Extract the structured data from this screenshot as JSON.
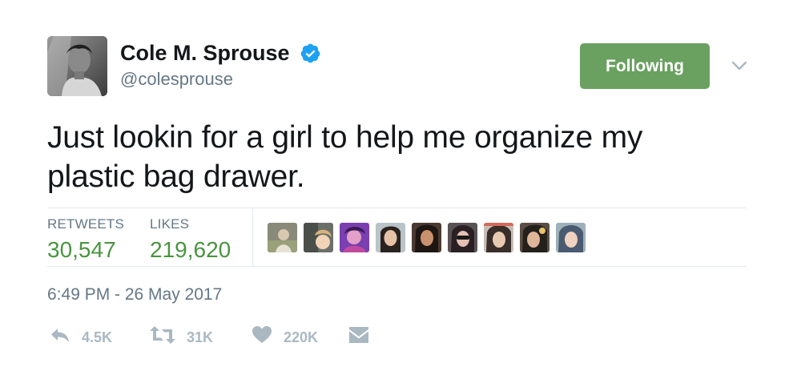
{
  "author": {
    "display_name": "Cole M. Sprouse",
    "handle": "@colesprouse",
    "verified": true
  },
  "follow_button": {
    "label": "Following",
    "color": "#6aa160"
  },
  "tweet": {
    "text": "Just lookin for a girl to help me organize my plastic bag drawer."
  },
  "stats": {
    "retweets_label": "RETWEETS",
    "retweets_value": "30,547",
    "likes_label": "LIKES",
    "likes_value": "219,620"
  },
  "liker_avatar_count": 9,
  "timestamp": "6:49 PM - 26 May 2017",
  "actions": {
    "reply_count": "4.5K",
    "retweet_count": "31K",
    "like_count": "220K"
  },
  "colors": {
    "verified": "#1da1f2",
    "stat_value": "#4a9440",
    "secondary_text": "#657786",
    "action_icon": "#aab8c2"
  }
}
